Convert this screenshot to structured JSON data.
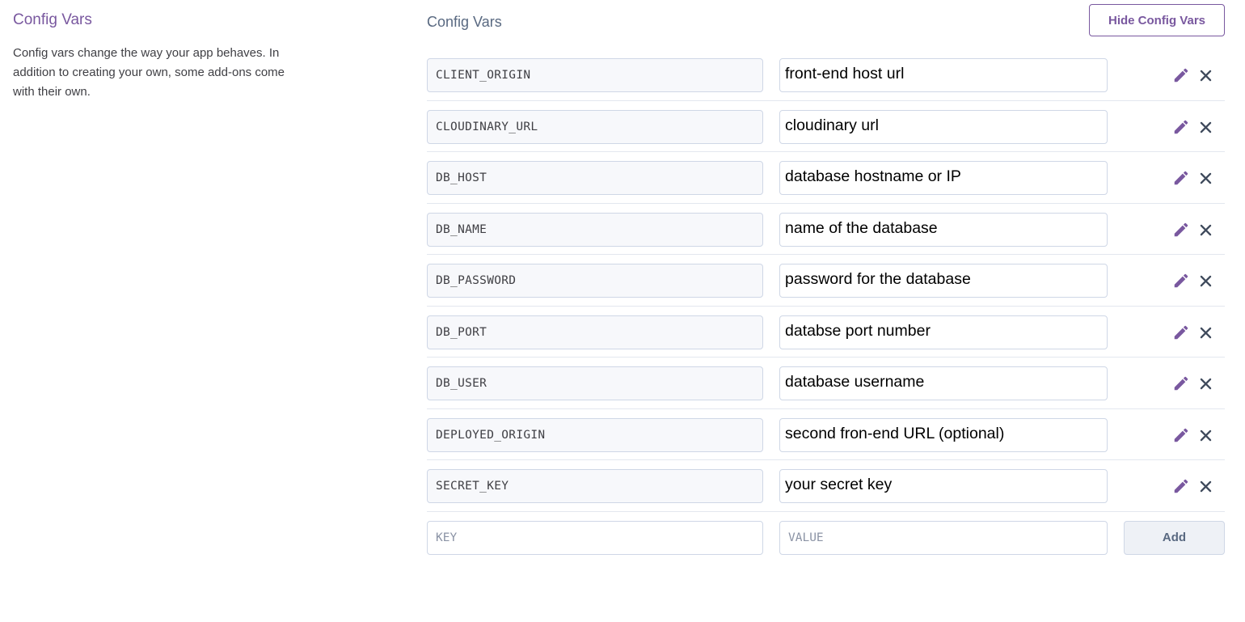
{
  "intro": {
    "title": "Config Vars",
    "description": "Config vars change the way your app behaves. In addition to creating your own, some add-ons come with their own."
  },
  "section": {
    "title": "Config Vars",
    "hide_button_label": "Hide Config Vars"
  },
  "config_vars": [
    {
      "key": "CLIENT_ORIGIN",
      "value": "front-end host url"
    },
    {
      "key": "CLOUDINARY_URL",
      "value": "cloudinary url"
    },
    {
      "key": "DB_HOST",
      "value": "database hostname or IP"
    },
    {
      "key": "DB_NAME",
      "value": "name of the database"
    },
    {
      "key": "DB_PASSWORD",
      "value": "password for the database"
    },
    {
      "key": "DB_PORT",
      "value": "databse port number"
    },
    {
      "key": "DB_USER",
      "value": "database username"
    },
    {
      "key": "DEPLOYED_ORIGIN",
      "value": "second fron-end URL (optional)"
    },
    {
      "key": "SECRET_KEY",
      "value": "your secret key"
    }
  ],
  "new_var": {
    "key_placeholder": "KEY",
    "value_placeholder": "VALUE",
    "add_button_label": "Add"
  },
  "icons": {
    "edit": "pencil-icon",
    "delete": "close-icon"
  },
  "colors": {
    "accent": "#79589f",
    "muted": "#596981",
    "border": "#cfd7e6"
  }
}
